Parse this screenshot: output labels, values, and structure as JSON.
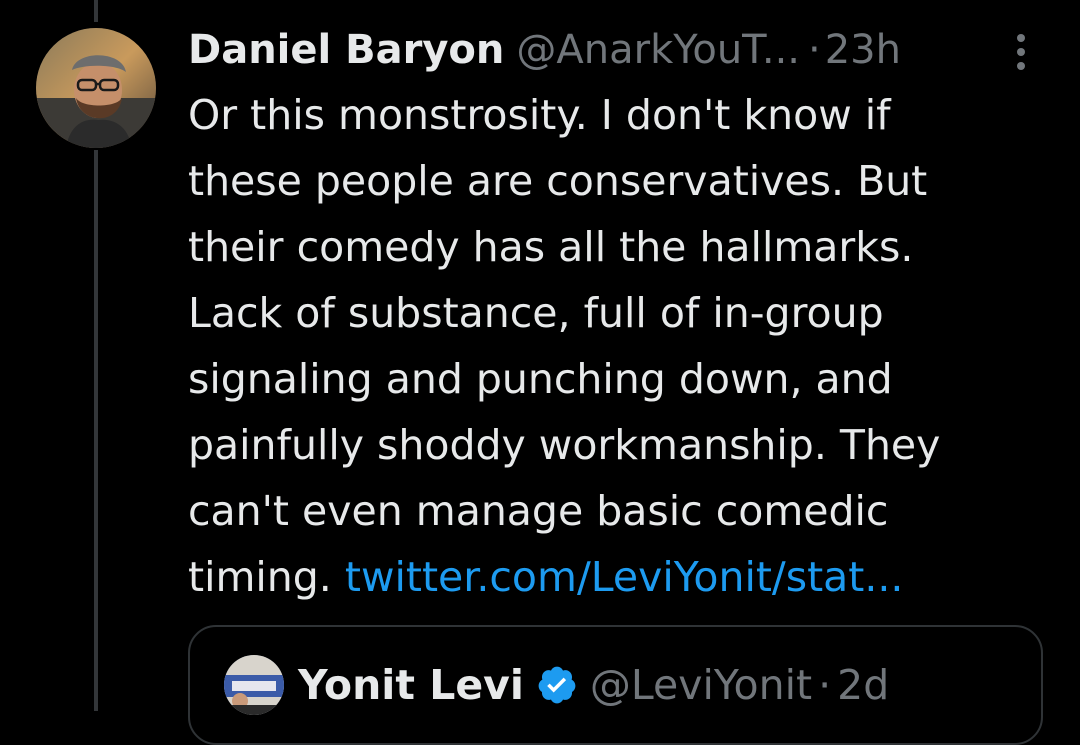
{
  "tweet": {
    "author": {
      "display_name": "Daniel Baryon",
      "handle": "@AnarkYouT...",
      "avatar_icon": "profile-photo-bearded-man-with-glasses"
    },
    "separator": "·",
    "timestamp": "23h",
    "more_icon": "more-options-icon",
    "text_lines": [
      "Or this monstrosity. I don't know if",
      "these people are conservatives. But",
      "their comedy has all the hallmarks.",
      "Lack of substance, full of in-group",
      "signaling and punching down, and",
      "painfully shoddy workmanship. They",
      "can't even manage basic comedic"
    ],
    "last_line_text": "timing.",
    "link_text": "twitter.com/LeviYonit/stat...",
    "link_color": "#1d9bf0"
  },
  "quoted_tweet": {
    "display_name": "Yonit Levi",
    "verified": true,
    "verified_icon": "verified-badge-icon",
    "verified_color": "#1d9bf0",
    "handle": "@LeviYonit",
    "separator": "·",
    "timestamp": "2d"
  },
  "theme": {
    "background": "#000000",
    "text_primary": "#e7e9ea",
    "text_secondary": "#71767b",
    "border": "#2f3336"
  }
}
